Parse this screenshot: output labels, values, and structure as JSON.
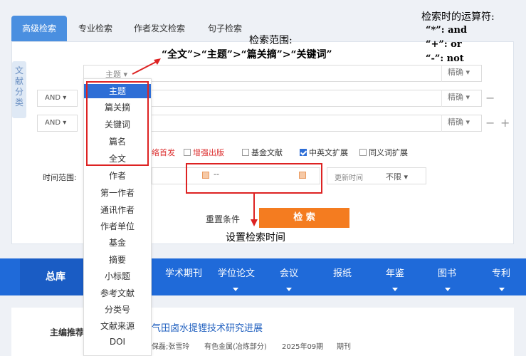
{
  "tabs": [
    "高级检索",
    "专业检索",
    "作者发文检索",
    "句子检索"
  ],
  "side_label": "文献分类",
  "rows": [
    {
      "field": "主题 ▾",
      "match": "精确 ▾"
    },
    {
      "logic": "AND ▾",
      "match": "精确 ▾"
    },
    {
      "logic": "AND ▾",
      "match": "精确 ▾"
    }
  ],
  "minus": "−",
  "plus": "+",
  "options": [
    {
      "label": "网络首发",
      "visible": "络首发",
      "checked": false,
      "red": true
    },
    {
      "label": "增强出版",
      "checked": false,
      "red": true
    },
    {
      "label": "基金文献",
      "checked": false
    },
    {
      "label": "中英文扩展",
      "checked": true
    },
    {
      "label": "同义词扩展",
      "checked": false
    }
  ],
  "time": {
    "label": "时间范围:",
    "sep": "--",
    "update_label": "更新时间",
    "update_value": "不限 ▾"
  },
  "buttons": {
    "reset": "重置条件",
    "search": "检 索"
  },
  "dropdown_items": [
    "主题",
    "篇关摘",
    "关键词",
    "篇名",
    "全文",
    "作者",
    "第一作者",
    "通讯作者",
    "作者单位",
    "基金",
    "摘要",
    "小标题",
    "参考文献",
    "分类号",
    "文献来源",
    "DOI"
  ],
  "nav": {
    "main": "总库",
    "items": [
      "学术期刊",
      "学位论文",
      "会议",
      "报纸",
      "年鉴",
      "图书",
      "专利"
    ]
  },
  "result": {
    "section": "主编推荐",
    "title_visible": "气田卤水提锂技术研究进展",
    "authors_visible": "保磊;张雪玲",
    "source": "有色金属(冶炼部分)",
    "issue": "2025年09期",
    "type": "期刊"
  },
  "annotations": {
    "scope_title": "检索范围:",
    "scope_order": "“全文”>“主题”>“篇关摘”>“关键词”",
    "ops_title": "检索时的运算符:",
    "op1": "“*”: and",
    "op2": "“+”: or",
    "op3": "“-”: not",
    "time_note": "设置检索时间"
  },
  "colors": {
    "accent": "#1f6ad9",
    "search_button": "#f47c20",
    "highlight_box": "#dd2222"
  }
}
